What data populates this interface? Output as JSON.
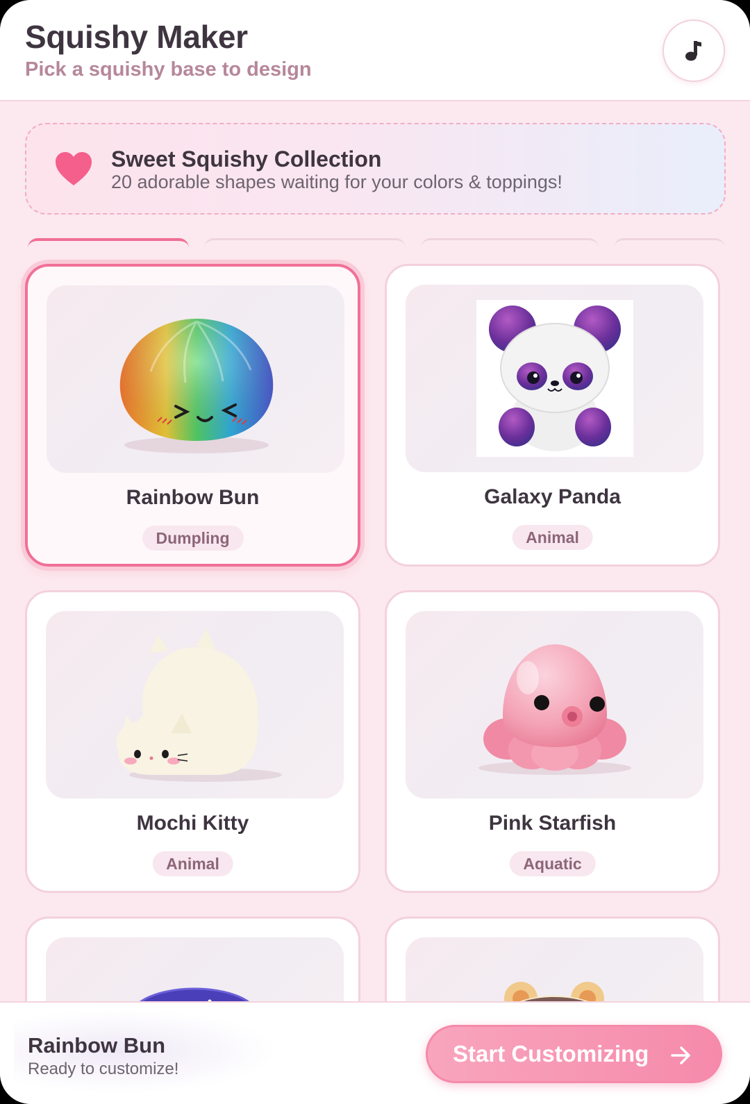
{
  "header": {
    "title": "Squishy Maker",
    "subtitle": "Pick a squishy base to design",
    "music_icon": "music-note-icon"
  },
  "banner": {
    "icon": "heart-icon",
    "title": "Sweet Squishy Collection",
    "text": "20 adorable shapes waiting for your colors & toppings!"
  },
  "squishies": [
    {
      "name": "Rainbow Bun",
      "category": "Dumpling",
      "selected": true
    },
    {
      "name": "Galaxy Panda",
      "category": "Animal",
      "selected": false
    },
    {
      "name": "Mochi Kitty",
      "category": "Animal",
      "selected": false
    },
    {
      "name": "Pink Starfish",
      "category": "Aquatic",
      "selected": false
    }
  ],
  "footer": {
    "selected_name": "Rainbow Bun",
    "status": "Ready to customize!",
    "cta_label": "Start Customizing",
    "cta_icon": "arrow-right-icon"
  },
  "colors": {
    "accent": "#f07098",
    "cta": "#f68aab",
    "background": "#fce9ef"
  }
}
